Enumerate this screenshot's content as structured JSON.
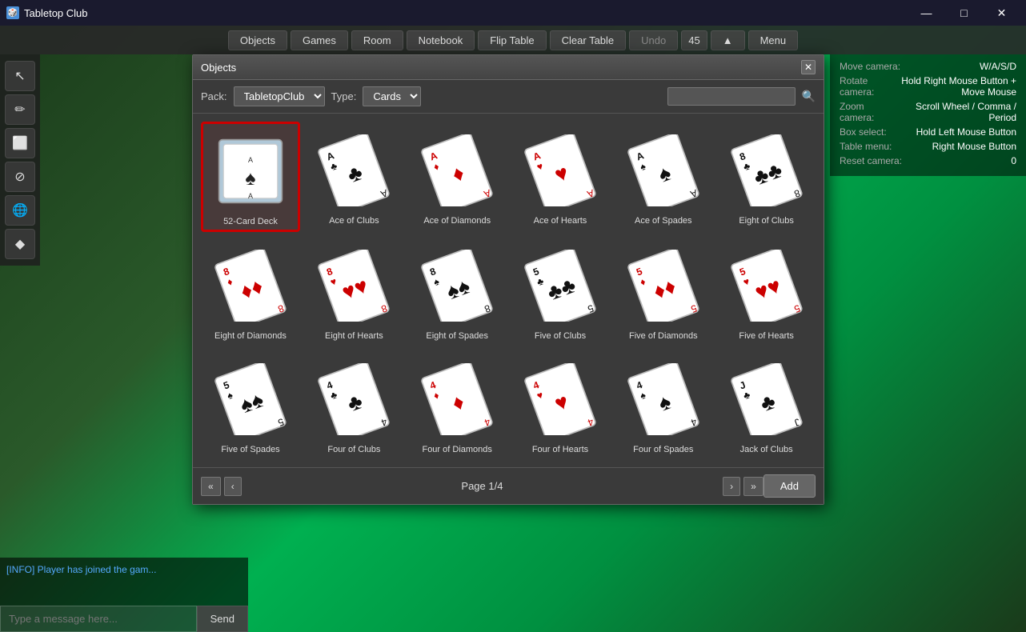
{
  "app": {
    "title": "Tabletop Club",
    "icon": "🎲"
  },
  "titlebar": {
    "minimize": "—",
    "maximize": "□",
    "close": "✕"
  },
  "menubar": {
    "buttons": [
      "Objects",
      "Games",
      "Room",
      "Notebook",
      "Flip Table",
      "Clear Table",
      "Undo",
      "45",
      "Menu"
    ]
  },
  "toolbar": {
    "tools": [
      "↖",
      "✏",
      "⬜",
      "⊘",
      "🌐",
      "◆"
    ]
  },
  "dialog": {
    "title": "Objects",
    "pack_label": "Pack:",
    "pack_value": "TabletopClub",
    "type_label": "Type:",
    "type_value": "Cards",
    "search_placeholder": "",
    "page_info": "Page 1/4",
    "add_label": "Add"
  },
  "chat": {
    "info_message": "[INFO] Player has joined the gam...",
    "input_placeholder": "Type a message here...",
    "send_label": "Send"
  },
  "help": {
    "items": [
      {
        "key": "Move camera:",
        "val": "W/A/S/D"
      },
      {
        "key": "Rotate camera:",
        "val": "Hold Right Mouse Button + Move Mouse"
      },
      {
        "key": "Zoom camera:",
        "val": "Scroll Wheel / Comma / Period"
      },
      {
        "key": "Box select:",
        "val": "Hold Left Mouse Button"
      },
      {
        "key": "Table menu:",
        "val": "Right Mouse Button"
      },
      {
        "key": "Reset camera:",
        "val": "0"
      }
    ]
  },
  "cards": [
    {
      "id": "52-card-deck",
      "label": "52-Card Deck",
      "suit": "spades",
      "rank": "A",
      "color": "black",
      "selected": true,
      "is_deck": true
    },
    {
      "id": "ace-clubs",
      "label": "Ace of Clubs",
      "suit": "clubs",
      "rank": "A",
      "color": "black"
    },
    {
      "id": "ace-diamonds",
      "label": "Ace of Diamonds",
      "suit": "diamonds",
      "rank": "A",
      "color": "red"
    },
    {
      "id": "ace-hearts",
      "label": "Ace of Hearts",
      "suit": "hearts",
      "rank": "A",
      "color": "red"
    },
    {
      "id": "ace-spades",
      "label": "Ace of Spades",
      "suit": "spades",
      "rank": "A",
      "color": "black"
    },
    {
      "id": "eight-clubs",
      "label": "Eight of Clubs",
      "suit": "clubs",
      "rank": "8",
      "color": "black"
    },
    {
      "id": "eight-diamonds",
      "label": "Eight of Diamonds",
      "suit": "diamonds",
      "rank": "8",
      "color": "red"
    },
    {
      "id": "eight-hearts",
      "label": "Eight of Hearts",
      "suit": "hearts",
      "rank": "8",
      "color": "red"
    },
    {
      "id": "eight-spades",
      "label": "Eight of Spades",
      "suit": "spades",
      "rank": "8",
      "color": "black"
    },
    {
      "id": "five-clubs",
      "label": "Five of Clubs",
      "suit": "clubs",
      "rank": "5",
      "color": "black"
    },
    {
      "id": "five-diamonds",
      "label": "Five of Diamonds",
      "suit": "diamonds",
      "rank": "5",
      "color": "red"
    },
    {
      "id": "five-hearts",
      "label": "Five of Hearts",
      "suit": "hearts",
      "rank": "5",
      "color": "red"
    },
    {
      "id": "five-spades",
      "label": "Five of Spades",
      "suit": "spades",
      "rank": "5",
      "color": "black"
    },
    {
      "id": "four-clubs",
      "label": "Four of Clubs",
      "suit": "clubs",
      "rank": "4",
      "color": "black"
    },
    {
      "id": "four-diamonds",
      "label": "Four of Diamonds",
      "suit": "diamonds",
      "rank": "4",
      "color": "red"
    },
    {
      "id": "four-hearts",
      "label": "Four of Hearts",
      "suit": "hearts",
      "rank": "4",
      "color": "red"
    },
    {
      "id": "four-spades",
      "label": "Four of Spades",
      "suit": "spades",
      "rank": "4",
      "color": "black"
    },
    {
      "id": "jack-clubs",
      "label": "Jack of Clubs",
      "suit": "clubs",
      "rank": "J",
      "color": "black"
    }
  ]
}
